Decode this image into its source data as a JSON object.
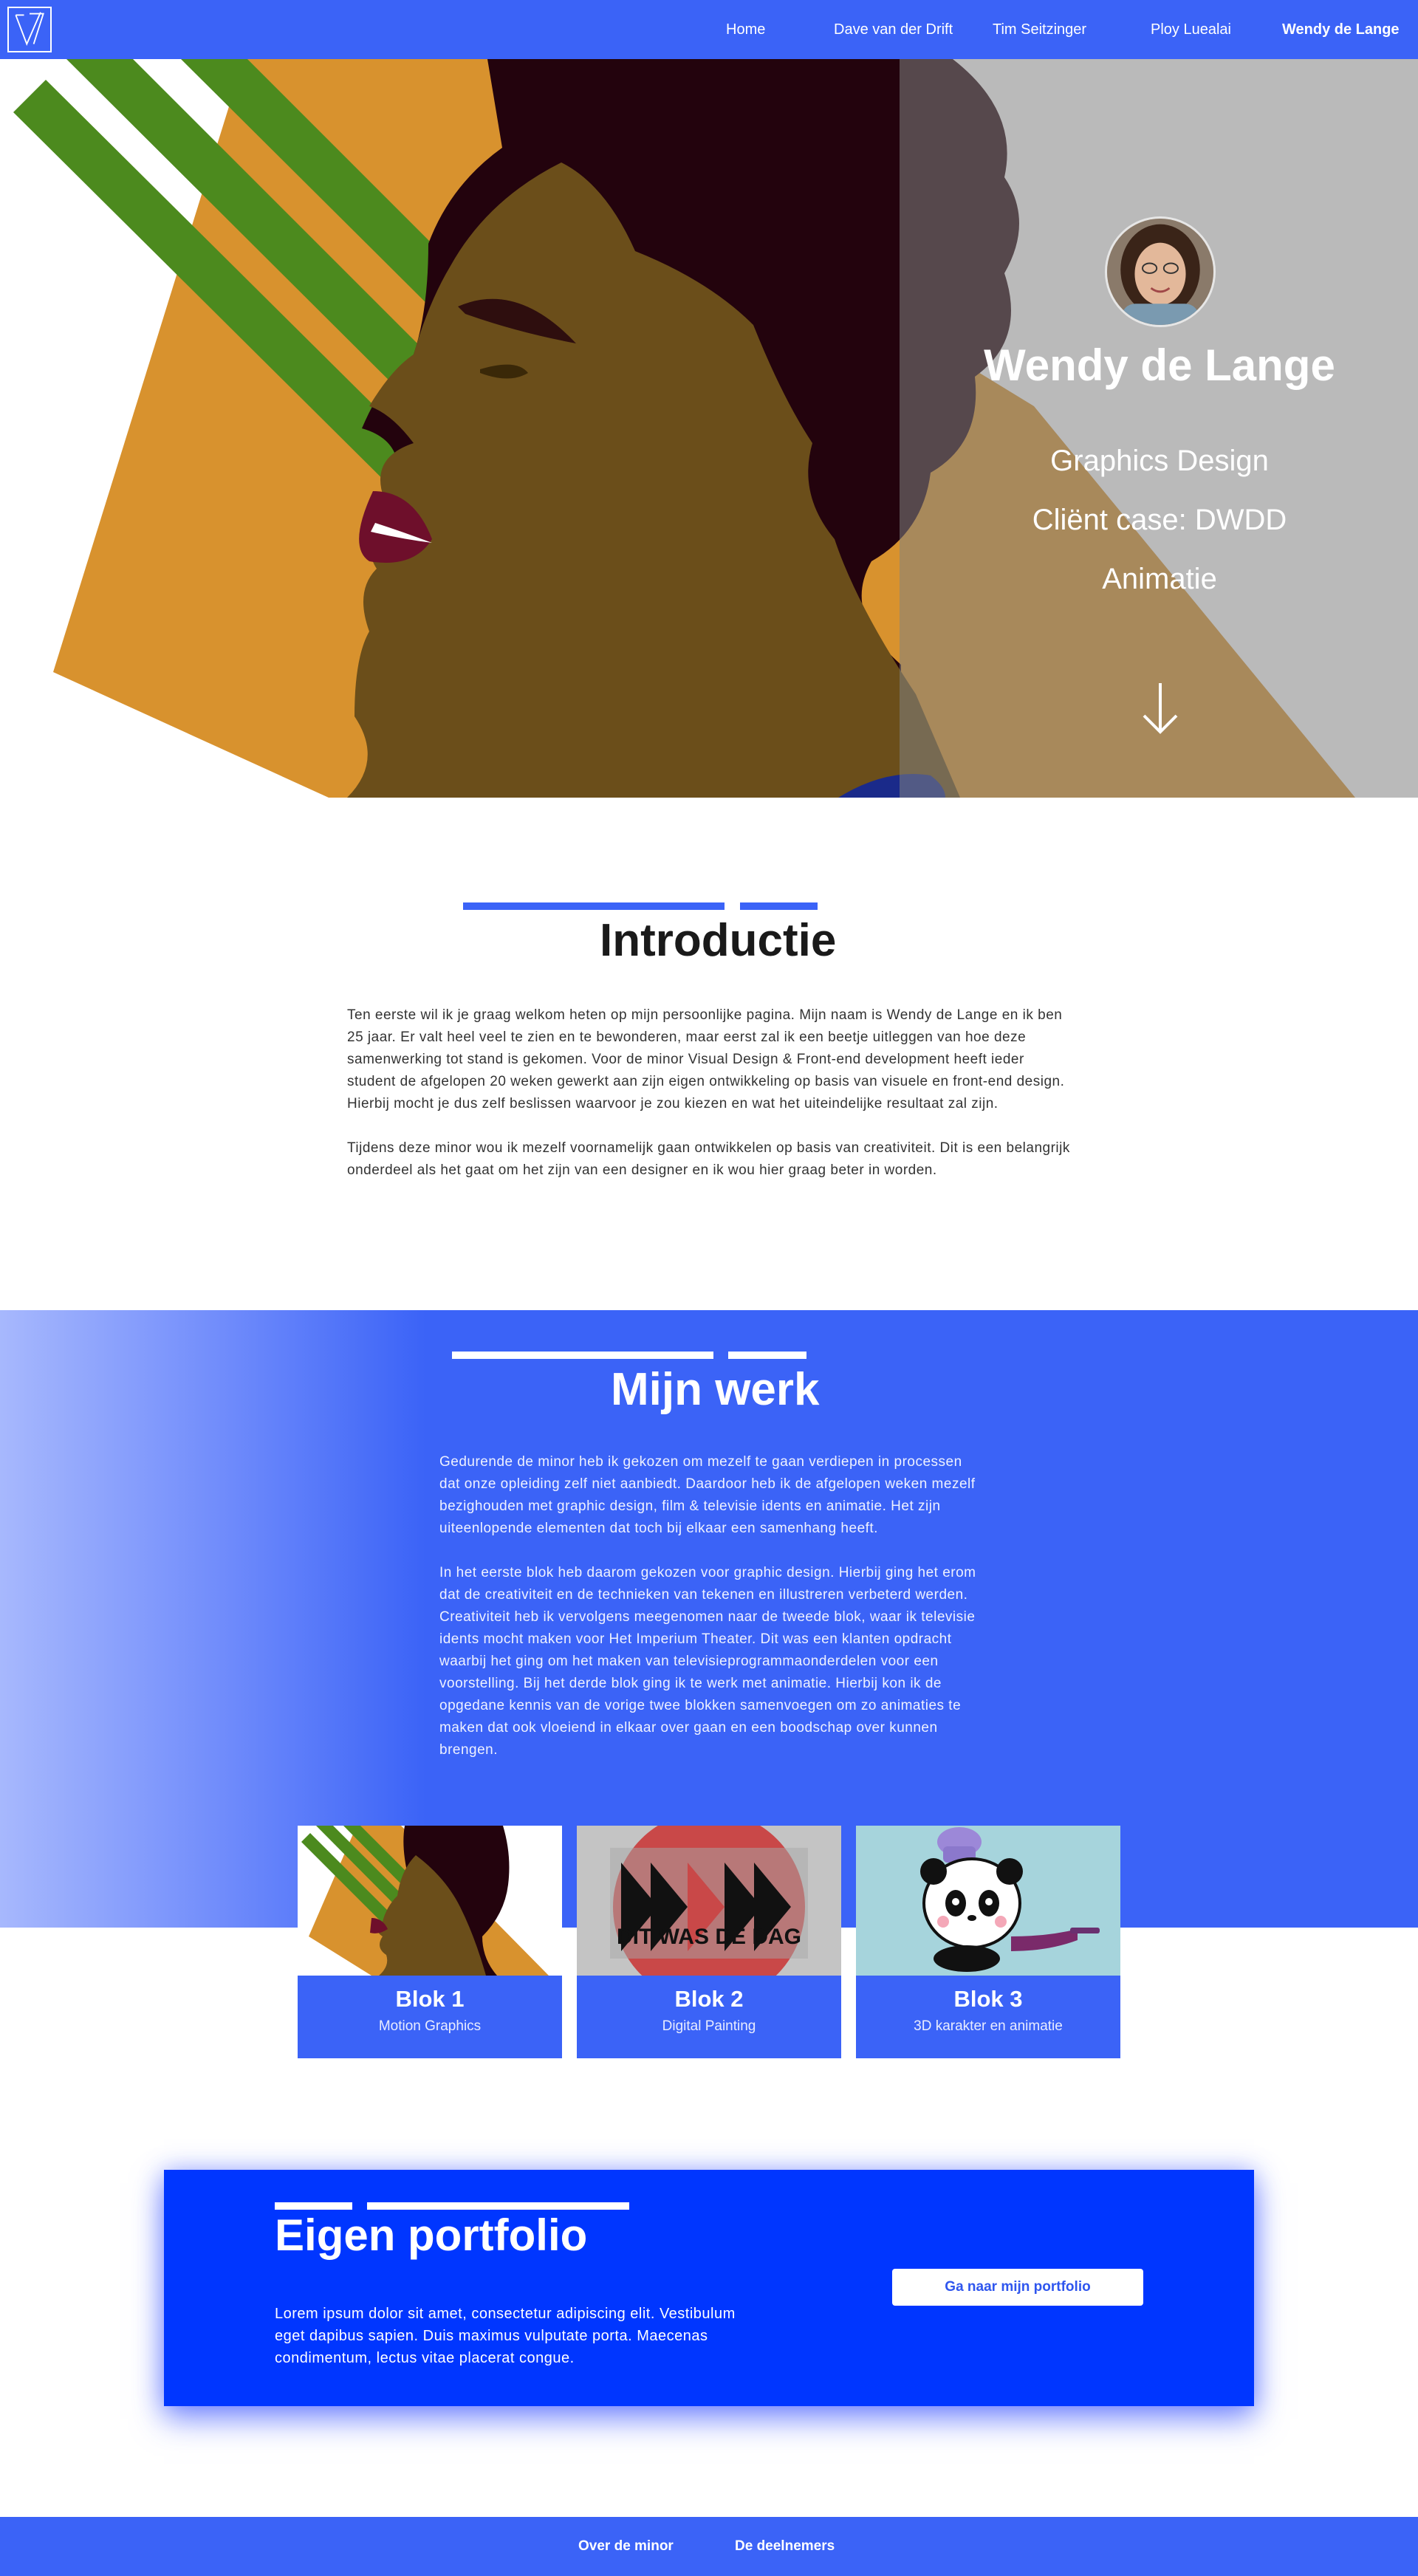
{
  "nav": {
    "items": [
      {
        "label": "Home",
        "active": false
      },
      {
        "label": "Dave van der Drift",
        "active": false
      },
      {
        "label": "Tim Seitzinger",
        "active": false
      },
      {
        "label": "Ploy Luealai",
        "active": false
      },
      {
        "label": "Wendy de Lange",
        "active": true
      }
    ]
  },
  "hero": {
    "name": "Wendy de Lange",
    "subtitles": [
      "Graphics Design",
      "Cliënt case: DWDD",
      "Animatie"
    ]
  },
  "intro": {
    "title": "Introductie",
    "paragraphs": [
      "Ten eerste wil ik je graag welkom heten op mijn persoonlijke pagina. Mijn naam is Wendy de Lange en ik ben 25 jaar. Er valt heel veel te zien en te bewonderen, maar eerst zal ik een beetje uitleggen van hoe deze samenwerking tot stand is gekomen. Voor de minor Visual Design & Front-end development heeft ieder student de afgelopen 20 weken gewerkt aan zijn eigen ontwikkeling op basis van visuele en front-end design. Hierbij mocht je dus zelf beslissen waarvoor je zou kiezen en wat het uiteindelijke resultaat zal zijn.",
      "Tijdens deze minor wou ik mezelf voornamelijk gaan ontwikkelen op basis van creativiteit. Dit is een belangrijk onderdeel als het gaat om het zijn van een designer en ik wou hier graag beter in worden."
    ]
  },
  "work": {
    "title": "Mijn werk",
    "paragraphs": [
      "Gedurende de minor heb ik gekozen om mezelf te gaan verdiepen in processen dat onze opleiding zelf niet aanbiedt. Daardoor heb ik de afgelopen weken mezelf bezighouden met graphic design, film & televisie idents en animatie. Het zijn uiteenlopende elementen dat toch bij elkaar een samenhang heeft.",
      "In het eerste blok heb daarom gekozen voor graphic design. Hierbij ging het erom dat de creativiteit en de technieken van tekenen en illustreren verbeterd werden. Creativiteit heb ik vervolgens meegenomen naar de tweede blok, waar ik televisie idents mocht maken voor Het Imperium Theater. Dit was een klanten opdracht waarbij het ging om het maken van televisieprogrammaonderdelen voor een voorstelling. Bij het derde blok ging ik te werk met animatie. Hierbij kon ik de opgedane kennis van de vorige twee blokken samenvoegen om zo animaties te maken dat ook vloeiend in elkaar over gaan en een boodschap over kunnen brengen."
    ],
    "cards": [
      {
        "title": "Blok 1",
        "subtitle": "Motion Graphics"
      },
      {
        "title": "Blok 2",
        "subtitle": "Digital Painting",
        "image_text": "DIT WAS DE DAG"
      },
      {
        "title": "Blok 3",
        "subtitle": "3D karakter en animatie"
      }
    ]
  },
  "portfolio": {
    "title": "Eigen portfolio",
    "text": " Lorem ipsum dolor sit amet, consectetur adipiscing elit. Vestibulum eget dapibus sapien. Duis maximus vulputate porta. Maecenas condimentum, lectus vitae placerat congue.",
    "button_label": "Ga naar mijn portfolio"
  },
  "footer": {
    "links": [
      "Over de minor",
      "De deelnemers"
    ]
  },
  "colors": {
    "primary_blue": "#3b63f7",
    "portfolio_blue": "#0036ff",
    "mustard": "#d8922e",
    "green": "#4c8a1e",
    "skin": "#6b4e1a",
    "hair": "#23030d"
  }
}
